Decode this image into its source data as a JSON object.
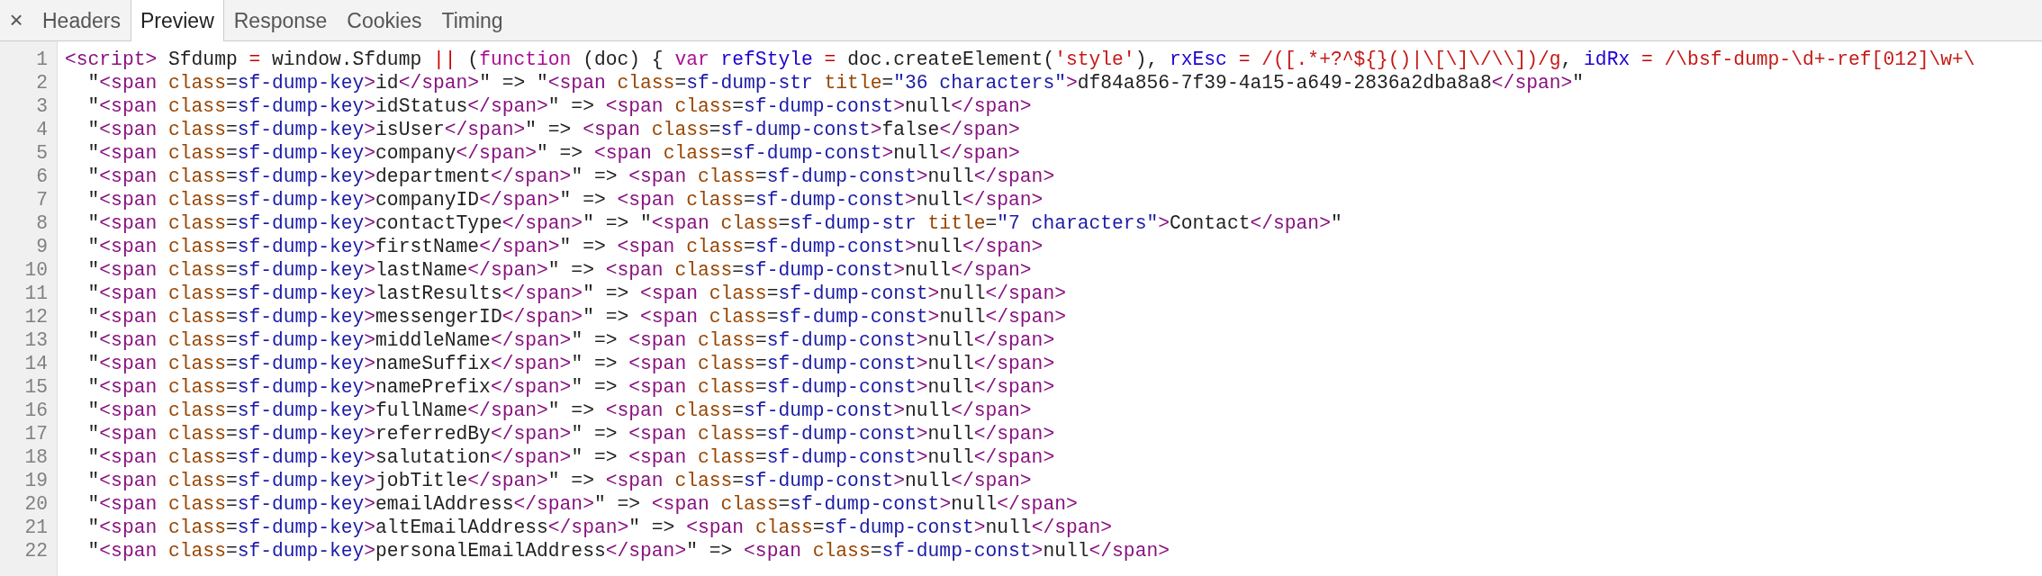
{
  "toolbar": {
    "close": "×",
    "tabs": [
      {
        "label": "Headers",
        "selected": false
      },
      {
        "label": "Preview",
        "selected": true
      },
      {
        "label": "Response",
        "selected": false
      },
      {
        "label": "Cookies",
        "selected": false
      },
      {
        "label": "Timing",
        "selected": false
      }
    ]
  },
  "code": {
    "lines": [
      {
        "number": "1",
        "tokens": [
          {
            "kind": "tag",
            "text": "<script>"
          },
          {
            "kind": "plain",
            "text": " Sfdump "
          },
          {
            "kind": "op",
            "text": "="
          },
          {
            "kind": "plain",
            "text": " window.Sfdump "
          },
          {
            "kind": "op",
            "text": "||"
          },
          {
            "kind": "plain",
            "text": " ("
          },
          {
            "kind": "keyword",
            "text": "function"
          },
          {
            "kind": "plain",
            "text": " (doc) { "
          },
          {
            "kind": "keyword",
            "text": "var"
          },
          {
            "kind": "var",
            "text": " refStyle"
          },
          {
            "kind": "op",
            "text": " = "
          },
          {
            "kind": "plain",
            "text": "doc.createElement("
          },
          {
            "kind": "string",
            "text": "'style'"
          },
          {
            "kind": "plain",
            "text": "), "
          },
          {
            "kind": "var",
            "text": "rxEsc"
          },
          {
            "kind": "op",
            "text": " = "
          },
          {
            "kind": "regex",
            "text": "/([.*+?^${}()|\\[\\]\\/\\\\])/g"
          },
          {
            "kind": "plain",
            "text": ", "
          },
          {
            "kind": "var",
            "text": "idRx"
          },
          {
            "kind": "op",
            "text": " = "
          },
          {
            "kind": "regex",
            "text": "/\\bsf-dump-\\d+-ref[012]\\w+\\"
          }
        ]
      },
      {
        "number": "2",
        "tokens": [
          {
            "kind": "plain",
            "text": "  \""
          },
          {
            "kind": "tag",
            "text": "<span "
          },
          {
            "kind": "attr",
            "text": "class"
          },
          {
            "kind": "plain",
            "text": "="
          },
          {
            "kind": "value",
            "text": "sf-dump-key"
          },
          {
            "kind": "tag",
            "text": ">"
          },
          {
            "kind": "plain",
            "text": "id"
          },
          {
            "kind": "tag",
            "text": "</span>"
          },
          {
            "kind": "plain",
            "text": "\" => \""
          },
          {
            "kind": "tag",
            "text": "<span "
          },
          {
            "kind": "attr",
            "text": "class"
          },
          {
            "kind": "plain",
            "text": "="
          },
          {
            "kind": "value",
            "text": "sf-dump-str"
          },
          {
            "kind": "attr",
            "text": " title"
          },
          {
            "kind": "plain",
            "text": "="
          },
          {
            "kind": "value",
            "text": "\"36 characters\""
          },
          {
            "kind": "tag",
            "text": ">"
          },
          {
            "kind": "plain",
            "text": "df84a856-7f39-4a15-a649-2836a2dba8a8"
          },
          {
            "kind": "tag",
            "text": "</span>"
          },
          {
            "kind": "plain",
            "text": "\""
          }
        ]
      },
      {
        "number": "3",
        "tokens": [
          {
            "kind": "plain",
            "text": "  \""
          },
          {
            "kind": "tag",
            "text": "<span "
          },
          {
            "kind": "attr",
            "text": "class"
          },
          {
            "kind": "plain",
            "text": "="
          },
          {
            "kind": "value",
            "text": "sf-dump-key"
          },
          {
            "kind": "tag",
            "text": ">"
          },
          {
            "kind": "plain",
            "text": "idStatus"
          },
          {
            "kind": "tag",
            "text": "</span>"
          },
          {
            "kind": "plain",
            "text": "\" => "
          },
          {
            "kind": "tag",
            "text": "<span "
          },
          {
            "kind": "attr",
            "text": "class"
          },
          {
            "kind": "plain",
            "text": "="
          },
          {
            "kind": "value",
            "text": "sf-dump-const"
          },
          {
            "kind": "tag",
            "text": ">"
          },
          {
            "kind": "plain",
            "text": "null"
          },
          {
            "kind": "tag",
            "text": "</span>"
          }
        ]
      },
      {
        "number": "4",
        "tokens": [
          {
            "kind": "plain",
            "text": "  \""
          },
          {
            "kind": "tag",
            "text": "<span "
          },
          {
            "kind": "attr",
            "text": "class"
          },
          {
            "kind": "plain",
            "text": "="
          },
          {
            "kind": "value",
            "text": "sf-dump-key"
          },
          {
            "kind": "tag",
            "text": ">"
          },
          {
            "kind": "plain",
            "text": "isUser"
          },
          {
            "kind": "tag",
            "text": "</span>"
          },
          {
            "kind": "plain",
            "text": "\" => "
          },
          {
            "kind": "tag",
            "text": "<span "
          },
          {
            "kind": "attr",
            "text": "class"
          },
          {
            "kind": "plain",
            "text": "="
          },
          {
            "kind": "value",
            "text": "sf-dump-const"
          },
          {
            "kind": "tag",
            "text": ">"
          },
          {
            "kind": "plain",
            "text": "false"
          },
          {
            "kind": "tag",
            "text": "</span>"
          }
        ]
      },
      {
        "number": "5",
        "tokens": [
          {
            "kind": "plain",
            "text": "  \""
          },
          {
            "kind": "tag",
            "text": "<span "
          },
          {
            "kind": "attr",
            "text": "class"
          },
          {
            "kind": "plain",
            "text": "="
          },
          {
            "kind": "value",
            "text": "sf-dump-key"
          },
          {
            "kind": "tag",
            "text": ">"
          },
          {
            "kind": "plain",
            "text": "company"
          },
          {
            "kind": "tag",
            "text": "</span>"
          },
          {
            "kind": "plain",
            "text": "\" => "
          },
          {
            "kind": "tag",
            "text": "<span "
          },
          {
            "kind": "attr",
            "text": "class"
          },
          {
            "kind": "plain",
            "text": "="
          },
          {
            "kind": "value",
            "text": "sf-dump-const"
          },
          {
            "kind": "tag",
            "text": ">"
          },
          {
            "kind": "plain",
            "text": "null"
          },
          {
            "kind": "tag",
            "text": "</span>"
          }
        ]
      },
      {
        "number": "6",
        "tokens": [
          {
            "kind": "plain",
            "text": "  \""
          },
          {
            "kind": "tag",
            "text": "<span "
          },
          {
            "kind": "attr",
            "text": "class"
          },
          {
            "kind": "plain",
            "text": "="
          },
          {
            "kind": "value",
            "text": "sf-dump-key"
          },
          {
            "kind": "tag",
            "text": ">"
          },
          {
            "kind": "plain",
            "text": "department"
          },
          {
            "kind": "tag",
            "text": "</span>"
          },
          {
            "kind": "plain",
            "text": "\" => "
          },
          {
            "kind": "tag",
            "text": "<span "
          },
          {
            "kind": "attr",
            "text": "class"
          },
          {
            "kind": "plain",
            "text": "="
          },
          {
            "kind": "value",
            "text": "sf-dump-const"
          },
          {
            "kind": "tag",
            "text": ">"
          },
          {
            "kind": "plain",
            "text": "null"
          },
          {
            "kind": "tag",
            "text": "</span>"
          }
        ]
      },
      {
        "number": "7",
        "tokens": [
          {
            "kind": "plain",
            "text": "  \""
          },
          {
            "kind": "tag",
            "text": "<span "
          },
          {
            "kind": "attr",
            "text": "class"
          },
          {
            "kind": "plain",
            "text": "="
          },
          {
            "kind": "value",
            "text": "sf-dump-key"
          },
          {
            "kind": "tag",
            "text": ">"
          },
          {
            "kind": "plain",
            "text": "companyID"
          },
          {
            "kind": "tag",
            "text": "</span>"
          },
          {
            "kind": "plain",
            "text": "\" => "
          },
          {
            "kind": "tag",
            "text": "<span "
          },
          {
            "kind": "attr",
            "text": "class"
          },
          {
            "kind": "plain",
            "text": "="
          },
          {
            "kind": "value",
            "text": "sf-dump-const"
          },
          {
            "kind": "tag",
            "text": ">"
          },
          {
            "kind": "plain",
            "text": "null"
          },
          {
            "kind": "tag",
            "text": "</span>"
          }
        ]
      },
      {
        "number": "8",
        "tokens": [
          {
            "kind": "plain",
            "text": "  \""
          },
          {
            "kind": "tag",
            "text": "<span "
          },
          {
            "kind": "attr",
            "text": "class"
          },
          {
            "kind": "plain",
            "text": "="
          },
          {
            "kind": "value",
            "text": "sf-dump-key"
          },
          {
            "kind": "tag",
            "text": ">"
          },
          {
            "kind": "plain",
            "text": "contactType"
          },
          {
            "kind": "tag",
            "text": "</span>"
          },
          {
            "kind": "plain",
            "text": "\" => \""
          },
          {
            "kind": "tag",
            "text": "<span "
          },
          {
            "kind": "attr",
            "text": "class"
          },
          {
            "kind": "plain",
            "text": "="
          },
          {
            "kind": "value",
            "text": "sf-dump-str"
          },
          {
            "kind": "attr",
            "text": " title"
          },
          {
            "kind": "plain",
            "text": "="
          },
          {
            "kind": "value",
            "text": "\"7 characters\""
          },
          {
            "kind": "tag",
            "text": ">"
          },
          {
            "kind": "plain",
            "text": "Contact"
          },
          {
            "kind": "tag",
            "text": "</span>"
          },
          {
            "kind": "plain",
            "text": "\""
          }
        ]
      },
      {
        "number": "9",
        "tokens": [
          {
            "kind": "plain",
            "text": "  \""
          },
          {
            "kind": "tag",
            "text": "<span "
          },
          {
            "kind": "attr",
            "text": "class"
          },
          {
            "kind": "plain",
            "text": "="
          },
          {
            "kind": "value",
            "text": "sf-dump-key"
          },
          {
            "kind": "tag",
            "text": ">"
          },
          {
            "kind": "plain",
            "text": "firstName"
          },
          {
            "kind": "tag",
            "text": "</span>"
          },
          {
            "kind": "plain",
            "text": "\" => "
          },
          {
            "kind": "tag",
            "text": "<span "
          },
          {
            "kind": "attr",
            "text": "class"
          },
          {
            "kind": "plain",
            "text": "="
          },
          {
            "kind": "value",
            "text": "sf-dump-const"
          },
          {
            "kind": "tag",
            "text": ">"
          },
          {
            "kind": "plain",
            "text": "null"
          },
          {
            "kind": "tag",
            "text": "</span>"
          }
        ]
      },
      {
        "number": "10",
        "tokens": [
          {
            "kind": "plain",
            "text": "  \""
          },
          {
            "kind": "tag",
            "text": "<span "
          },
          {
            "kind": "attr",
            "text": "class"
          },
          {
            "kind": "plain",
            "text": "="
          },
          {
            "kind": "value",
            "text": "sf-dump-key"
          },
          {
            "kind": "tag",
            "text": ">"
          },
          {
            "kind": "plain",
            "text": "lastName"
          },
          {
            "kind": "tag",
            "text": "</span>"
          },
          {
            "kind": "plain",
            "text": "\" => "
          },
          {
            "kind": "tag",
            "text": "<span "
          },
          {
            "kind": "attr",
            "text": "class"
          },
          {
            "kind": "plain",
            "text": "="
          },
          {
            "kind": "value",
            "text": "sf-dump-const"
          },
          {
            "kind": "tag",
            "text": ">"
          },
          {
            "kind": "plain",
            "text": "null"
          },
          {
            "kind": "tag",
            "text": "</span>"
          }
        ]
      },
      {
        "number": "11",
        "tokens": [
          {
            "kind": "plain",
            "text": "  \""
          },
          {
            "kind": "tag",
            "text": "<span "
          },
          {
            "kind": "attr",
            "text": "class"
          },
          {
            "kind": "plain",
            "text": "="
          },
          {
            "kind": "value",
            "text": "sf-dump-key"
          },
          {
            "kind": "tag",
            "text": ">"
          },
          {
            "kind": "plain",
            "text": "lastResults"
          },
          {
            "kind": "tag",
            "text": "</span>"
          },
          {
            "kind": "plain",
            "text": "\" => "
          },
          {
            "kind": "tag",
            "text": "<span "
          },
          {
            "kind": "attr",
            "text": "class"
          },
          {
            "kind": "plain",
            "text": "="
          },
          {
            "kind": "value",
            "text": "sf-dump-const"
          },
          {
            "kind": "tag",
            "text": ">"
          },
          {
            "kind": "plain",
            "text": "null"
          },
          {
            "kind": "tag",
            "text": "</span>"
          }
        ]
      },
      {
        "number": "12",
        "tokens": [
          {
            "kind": "plain",
            "text": "  \""
          },
          {
            "kind": "tag",
            "text": "<span "
          },
          {
            "kind": "attr",
            "text": "class"
          },
          {
            "kind": "plain",
            "text": "="
          },
          {
            "kind": "value",
            "text": "sf-dump-key"
          },
          {
            "kind": "tag",
            "text": ">"
          },
          {
            "kind": "plain",
            "text": "messengerID"
          },
          {
            "kind": "tag",
            "text": "</span>"
          },
          {
            "kind": "plain",
            "text": "\" => "
          },
          {
            "kind": "tag",
            "text": "<span "
          },
          {
            "kind": "attr",
            "text": "class"
          },
          {
            "kind": "plain",
            "text": "="
          },
          {
            "kind": "value",
            "text": "sf-dump-const"
          },
          {
            "kind": "tag",
            "text": ">"
          },
          {
            "kind": "plain",
            "text": "null"
          },
          {
            "kind": "tag",
            "text": "</span>"
          }
        ]
      },
      {
        "number": "13",
        "tokens": [
          {
            "kind": "plain",
            "text": "  \""
          },
          {
            "kind": "tag",
            "text": "<span "
          },
          {
            "kind": "attr",
            "text": "class"
          },
          {
            "kind": "plain",
            "text": "="
          },
          {
            "kind": "value",
            "text": "sf-dump-key"
          },
          {
            "kind": "tag",
            "text": ">"
          },
          {
            "kind": "plain",
            "text": "middleName"
          },
          {
            "kind": "tag",
            "text": "</span>"
          },
          {
            "kind": "plain",
            "text": "\" => "
          },
          {
            "kind": "tag",
            "text": "<span "
          },
          {
            "kind": "attr",
            "text": "class"
          },
          {
            "kind": "plain",
            "text": "="
          },
          {
            "kind": "value",
            "text": "sf-dump-const"
          },
          {
            "kind": "tag",
            "text": ">"
          },
          {
            "kind": "plain",
            "text": "null"
          },
          {
            "kind": "tag",
            "text": "</span>"
          }
        ]
      },
      {
        "number": "14",
        "tokens": [
          {
            "kind": "plain",
            "text": "  \""
          },
          {
            "kind": "tag",
            "text": "<span "
          },
          {
            "kind": "attr",
            "text": "class"
          },
          {
            "kind": "plain",
            "text": "="
          },
          {
            "kind": "value",
            "text": "sf-dump-key"
          },
          {
            "kind": "tag",
            "text": ">"
          },
          {
            "kind": "plain",
            "text": "nameSuffix"
          },
          {
            "kind": "tag",
            "text": "</span>"
          },
          {
            "kind": "plain",
            "text": "\" => "
          },
          {
            "kind": "tag",
            "text": "<span "
          },
          {
            "kind": "attr",
            "text": "class"
          },
          {
            "kind": "plain",
            "text": "="
          },
          {
            "kind": "value",
            "text": "sf-dump-const"
          },
          {
            "kind": "tag",
            "text": ">"
          },
          {
            "kind": "plain",
            "text": "null"
          },
          {
            "kind": "tag",
            "text": "</span>"
          }
        ]
      },
      {
        "number": "15",
        "tokens": [
          {
            "kind": "plain",
            "text": "  \""
          },
          {
            "kind": "tag",
            "text": "<span "
          },
          {
            "kind": "attr",
            "text": "class"
          },
          {
            "kind": "plain",
            "text": "="
          },
          {
            "kind": "value",
            "text": "sf-dump-key"
          },
          {
            "kind": "tag",
            "text": ">"
          },
          {
            "kind": "plain",
            "text": "namePrefix"
          },
          {
            "kind": "tag",
            "text": "</span>"
          },
          {
            "kind": "plain",
            "text": "\" => "
          },
          {
            "kind": "tag",
            "text": "<span "
          },
          {
            "kind": "attr",
            "text": "class"
          },
          {
            "kind": "plain",
            "text": "="
          },
          {
            "kind": "value",
            "text": "sf-dump-const"
          },
          {
            "kind": "tag",
            "text": ">"
          },
          {
            "kind": "plain",
            "text": "null"
          },
          {
            "kind": "tag",
            "text": "</span>"
          }
        ]
      },
      {
        "number": "16",
        "tokens": [
          {
            "kind": "plain",
            "text": "  \""
          },
          {
            "kind": "tag",
            "text": "<span "
          },
          {
            "kind": "attr",
            "text": "class"
          },
          {
            "kind": "plain",
            "text": "="
          },
          {
            "kind": "value",
            "text": "sf-dump-key"
          },
          {
            "kind": "tag",
            "text": ">"
          },
          {
            "kind": "plain",
            "text": "fullName"
          },
          {
            "kind": "tag",
            "text": "</span>"
          },
          {
            "kind": "plain",
            "text": "\" => "
          },
          {
            "kind": "tag",
            "text": "<span "
          },
          {
            "kind": "attr",
            "text": "class"
          },
          {
            "kind": "plain",
            "text": "="
          },
          {
            "kind": "value",
            "text": "sf-dump-const"
          },
          {
            "kind": "tag",
            "text": ">"
          },
          {
            "kind": "plain",
            "text": "null"
          },
          {
            "kind": "tag",
            "text": "</span>"
          }
        ]
      },
      {
        "number": "17",
        "tokens": [
          {
            "kind": "plain",
            "text": "  \""
          },
          {
            "kind": "tag",
            "text": "<span "
          },
          {
            "kind": "attr",
            "text": "class"
          },
          {
            "kind": "plain",
            "text": "="
          },
          {
            "kind": "value",
            "text": "sf-dump-key"
          },
          {
            "kind": "tag",
            "text": ">"
          },
          {
            "kind": "plain",
            "text": "referredBy"
          },
          {
            "kind": "tag",
            "text": "</span>"
          },
          {
            "kind": "plain",
            "text": "\" => "
          },
          {
            "kind": "tag",
            "text": "<span "
          },
          {
            "kind": "attr",
            "text": "class"
          },
          {
            "kind": "plain",
            "text": "="
          },
          {
            "kind": "value",
            "text": "sf-dump-const"
          },
          {
            "kind": "tag",
            "text": ">"
          },
          {
            "kind": "plain",
            "text": "null"
          },
          {
            "kind": "tag",
            "text": "</span>"
          }
        ]
      },
      {
        "number": "18",
        "tokens": [
          {
            "kind": "plain",
            "text": "  \""
          },
          {
            "kind": "tag",
            "text": "<span "
          },
          {
            "kind": "attr",
            "text": "class"
          },
          {
            "kind": "plain",
            "text": "="
          },
          {
            "kind": "value",
            "text": "sf-dump-key"
          },
          {
            "kind": "tag",
            "text": ">"
          },
          {
            "kind": "plain",
            "text": "salutation"
          },
          {
            "kind": "tag",
            "text": "</span>"
          },
          {
            "kind": "plain",
            "text": "\" => "
          },
          {
            "kind": "tag",
            "text": "<span "
          },
          {
            "kind": "attr",
            "text": "class"
          },
          {
            "kind": "plain",
            "text": "="
          },
          {
            "kind": "value",
            "text": "sf-dump-const"
          },
          {
            "kind": "tag",
            "text": ">"
          },
          {
            "kind": "plain",
            "text": "null"
          },
          {
            "kind": "tag",
            "text": "</span>"
          }
        ]
      },
      {
        "number": "19",
        "tokens": [
          {
            "kind": "plain",
            "text": "  \""
          },
          {
            "kind": "tag",
            "text": "<span "
          },
          {
            "kind": "attr",
            "text": "class"
          },
          {
            "kind": "plain",
            "text": "="
          },
          {
            "kind": "value",
            "text": "sf-dump-key"
          },
          {
            "kind": "tag",
            "text": ">"
          },
          {
            "kind": "plain",
            "text": "jobTitle"
          },
          {
            "kind": "tag",
            "text": "</span>"
          },
          {
            "kind": "plain",
            "text": "\" => "
          },
          {
            "kind": "tag",
            "text": "<span "
          },
          {
            "kind": "attr",
            "text": "class"
          },
          {
            "kind": "plain",
            "text": "="
          },
          {
            "kind": "value",
            "text": "sf-dump-const"
          },
          {
            "kind": "tag",
            "text": ">"
          },
          {
            "kind": "plain",
            "text": "null"
          },
          {
            "kind": "tag",
            "text": "</span>"
          }
        ]
      },
      {
        "number": "20",
        "tokens": [
          {
            "kind": "plain",
            "text": "  \""
          },
          {
            "kind": "tag",
            "text": "<span "
          },
          {
            "kind": "attr",
            "text": "class"
          },
          {
            "kind": "plain",
            "text": "="
          },
          {
            "kind": "value",
            "text": "sf-dump-key"
          },
          {
            "kind": "tag",
            "text": ">"
          },
          {
            "kind": "plain",
            "text": "emailAddress"
          },
          {
            "kind": "tag",
            "text": "</span>"
          },
          {
            "kind": "plain",
            "text": "\" => "
          },
          {
            "kind": "tag",
            "text": "<span "
          },
          {
            "kind": "attr",
            "text": "class"
          },
          {
            "kind": "plain",
            "text": "="
          },
          {
            "kind": "value",
            "text": "sf-dump-const"
          },
          {
            "kind": "tag",
            "text": ">"
          },
          {
            "kind": "plain",
            "text": "null"
          },
          {
            "kind": "tag",
            "text": "</span>"
          }
        ]
      },
      {
        "number": "21",
        "tokens": [
          {
            "kind": "plain",
            "text": "  \""
          },
          {
            "kind": "tag",
            "text": "<span "
          },
          {
            "kind": "attr",
            "text": "class"
          },
          {
            "kind": "plain",
            "text": "="
          },
          {
            "kind": "value",
            "text": "sf-dump-key"
          },
          {
            "kind": "tag",
            "text": ">"
          },
          {
            "kind": "plain",
            "text": "altEmailAddress"
          },
          {
            "kind": "tag",
            "text": "</span>"
          },
          {
            "kind": "plain",
            "text": "\" => "
          },
          {
            "kind": "tag",
            "text": "<span "
          },
          {
            "kind": "attr",
            "text": "class"
          },
          {
            "kind": "plain",
            "text": "="
          },
          {
            "kind": "value",
            "text": "sf-dump-const"
          },
          {
            "kind": "tag",
            "text": ">"
          },
          {
            "kind": "plain",
            "text": "null"
          },
          {
            "kind": "tag",
            "text": "</span>"
          }
        ]
      },
      {
        "number": "22",
        "tokens": [
          {
            "kind": "plain",
            "text": "  \""
          },
          {
            "kind": "tag",
            "text": "<span "
          },
          {
            "kind": "attr",
            "text": "class"
          },
          {
            "kind": "plain",
            "text": "="
          },
          {
            "kind": "value",
            "text": "sf-dump-key"
          },
          {
            "kind": "tag",
            "text": ">"
          },
          {
            "kind": "plain",
            "text": "personalEmailAddress"
          },
          {
            "kind": "tag",
            "text": "</span>"
          },
          {
            "kind": "plain",
            "text": "\" => "
          },
          {
            "kind": "tag",
            "text": "<span "
          },
          {
            "kind": "attr",
            "text": "class"
          },
          {
            "kind": "plain",
            "text": "="
          },
          {
            "kind": "value",
            "text": "sf-dump-const"
          },
          {
            "kind": "tag",
            "text": ">"
          },
          {
            "kind": "plain",
            "text": "null"
          },
          {
            "kind": "tag",
            "text": "</span>"
          }
        ]
      }
    ]
  }
}
